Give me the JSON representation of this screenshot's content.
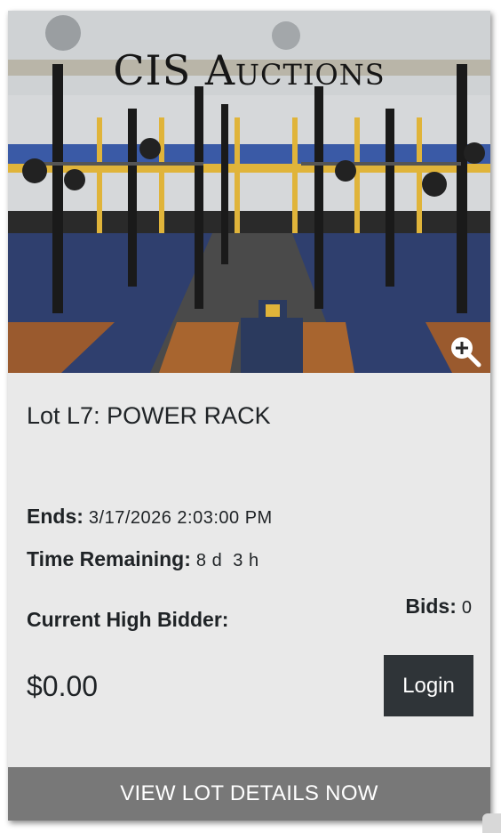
{
  "brand": "CIS Auctions",
  "lot": {
    "title": "Lot L7: POWER RACK"
  },
  "ends": {
    "label": "Ends:",
    "value": "3/17/2026 2:03:00 PM"
  },
  "time_remaining": {
    "label": "Time Remaining:",
    "value": "8 d  3 h"
  },
  "high_bidder": {
    "label": "Current High Bidder:"
  },
  "bids": {
    "label": "Bids:",
    "value": "0"
  },
  "price": "$0.00",
  "buttons": {
    "login": "Login",
    "view_details": "VIEW LOT DETAILS NOW"
  },
  "icons": {
    "zoom": "zoom-in-icon"
  },
  "colors": {
    "card_bg": "#e9e9e9",
    "login_bg": "#2f3438",
    "details_bar_bg": "#787878",
    "text": "#1f2326"
  }
}
